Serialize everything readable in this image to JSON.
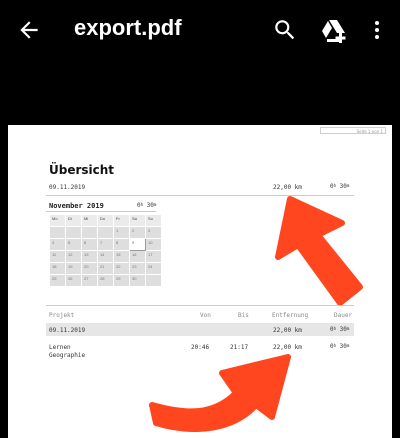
{
  "appbar": {
    "title": "export.pdf",
    "icons": [
      "back-arrow-icon",
      "search-icon",
      "drive-add-icon",
      "more-vert-icon"
    ]
  },
  "page": {
    "page_number": "Seite 1 von 1",
    "heading": "Übersicht",
    "summary": {
      "date": "09.11.2019",
      "distance": "22,00 km",
      "duration_h": "0",
      "duration_m": "30"
    },
    "calendar": {
      "month": "November 2019",
      "duration_h": "0",
      "duration_m": "30",
      "weekdays": [
        "Mo",
        "Di",
        "Mi",
        "Do",
        "Fr",
        "Sa",
        "So"
      ],
      "rows": [
        [
          "",
          "",
          "",
          "",
          "1",
          "2",
          "3"
        ],
        [
          "4",
          "5",
          "6",
          "7",
          "8",
          "9",
          "10"
        ],
        [
          "11",
          "12",
          "13",
          "14",
          "15",
          "16",
          "17"
        ],
        [
          "18",
          "19",
          "20",
          "21",
          "22",
          "23",
          "24"
        ],
        [
          "25",
          "26",
          "27",
          "28",
          "29",
          "30",
          ""
        ]
      ]
    },
    "table": {
      "headers": {
        "project": "Projekt",
        "from": "Von",
        "to": "Bis",
        "distance": "Entfernung",
        "duration": "Dauer"
      },
      "group": {
        "date": "09.11.2019",
        "distance": "22,00 km",
        "duration_h": "0",
        "duration_m": "30"
      },
      "row": {
        "project": "Lernen",
        "subject": "Geographie",
        "from": "20:46",
        "to": "21:17",
        "distance": "22,00 km",
        "duration_h": "0",
        "duration_m": "30"
      }
    }
  },
  "colors": {
    "marker": "#ff3d14",
    "background": "#000000",
    "paper": "#ffffff"
  }
}
